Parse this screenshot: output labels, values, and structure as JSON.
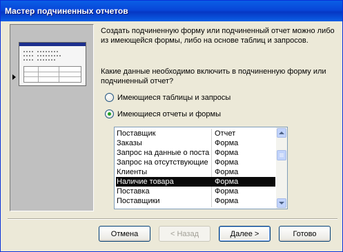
{
  "window": {
    "title": "Мастер подчиненных отчетов"
  },
  "intro": {
    "text": "Создать подчиненную форму или подчиненный отчет можно либо из имеющейся формы, либо на основе таблиц и запросов."
  },
  "question": {
    "text": "Какие данные необходимо включить в подчиненную форму или подчиненный отчет?"
  },
  "options": [
    {
      "label": "Имеющиеся таблицы и запросы",
      "selected": false
    },
    {
      "label": "Имеющиеся отчеты и формы",
      "selected": true
    }
  ],
  "list": {
    "rows": [
      {
        "name": "Поставщик",
        "type": "Отчет",
        "selected": false
      },
      {
        "name": "Заказы",
        "type": "Форма",
        "selected": false
      },
      {
        "name": "Запрос на данные о поставщиках",
        "type": "Форма",
        "selected": false
      },
      {
        "name": "Запрос на отсутствующие",
        "type": "Форма",
        "selected": false
      },
      {
        "name": "Клиенты",
        "type": "Форма",
        "selected": false
      },
      {
        "name": "Наличие товара",
        "type": "Форма",
        "selected": true
      },
      {
        "name": "Поставка",
        "type": "Форма",
        "selected": false
      },
      {
        "name": "Поставщики",
        "type": "Форма",
        "selected": false
      }
    ]
  },
  "buttons": {
    "cancel": "Отмена",
    "back": "< Назад",
    "next": "Далее >",
    "finish": "Готово"
  },
  "colors": {
    "titlebar": "#0a5fe6",
    "selection": "#0a0a0a",
    "dialog_bg": "#ece9d8"
  }
}
